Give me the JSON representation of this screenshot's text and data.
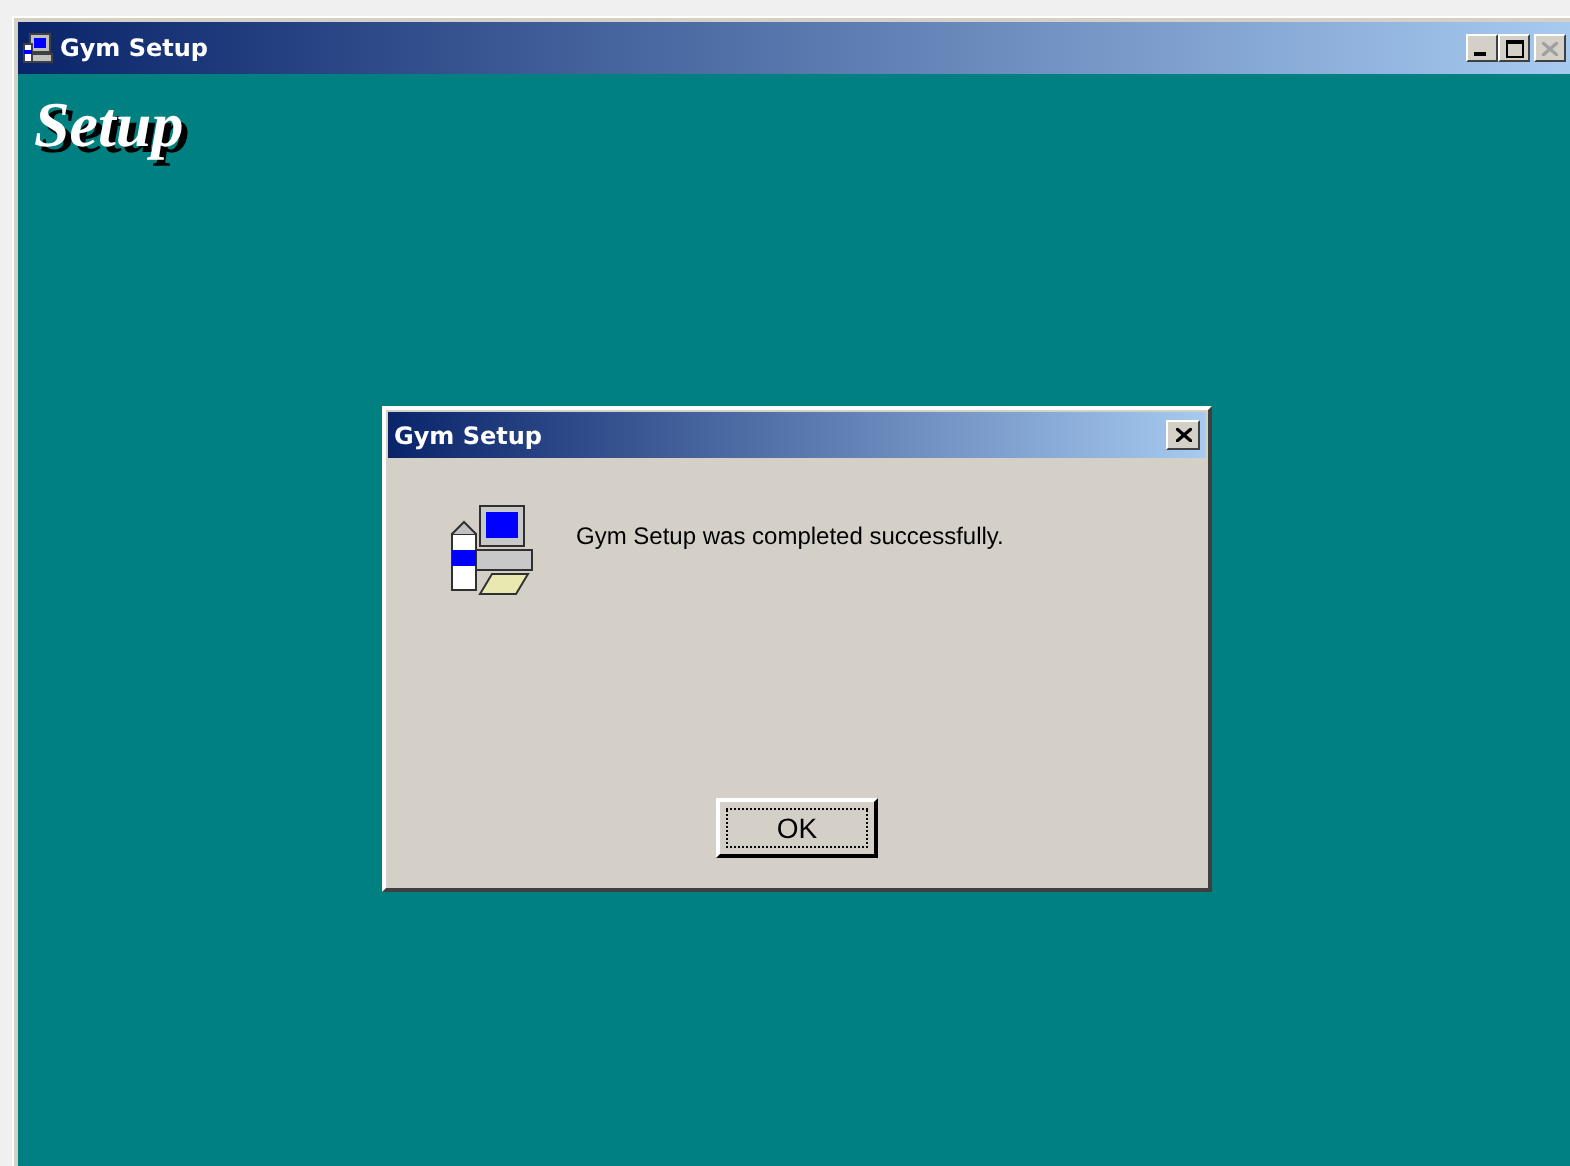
{
  "window": {
    "title": "Gym Setup",
    "controls": [
      {
        "kind": "minimize",
        "disabled": false
      },
      {
        "kind": "maximize",
        "disabled": false
      },
      {
        "kind": "close",
        "disabled": true
      }
    ]
  },
  "heading": "Setup",
  "dialog": {
    "title": "Gym Setup",
    "close_disabled": false,
    "message": "Gym Setup was completed successfully.",
    "button": "OK"
  }
}
